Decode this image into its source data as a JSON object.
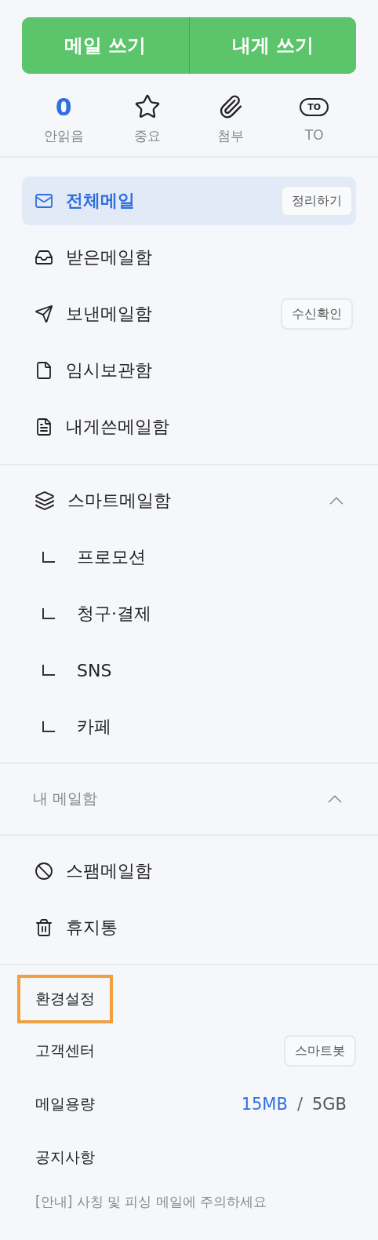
{
  "compose_buttons": [
    {
      "label": "메일 쓰기"
    },
    {
      "label": "내게 쓰기"
    }
  ],
  "quick_filters": [
    {
      "kind": "count",
      "value": "0",
      "label": "안읽음"
    },
    {
      "kind": "star",
      "label": "중요"
    },
    {
      "kind": "clip",
      "label": "첨부"
    },
    {
      "kind": "tag",
      "tag_text": "TO",
      "label": "TO"
    }
  ],
  "folders": [
    {
      "kind": "mail",
      "label": "전체메일",
      "selected": true,
      "action": "정리하기"
    },
    {
      "kind": "inbox",
      "label": "받은메일함",
      "selected": false
    },
    {
      "kind": "send",
      "label": "보낸메일함",
      "selected": false,
      "action": "수신확인"
    },
    {
      "kind": "draft",
      "label": "임시보관함",
      "selected": false
    },
    {
      "kind": "note",
      "label": "내게쓴메일함",
      "selected": false
    }
  ],
  "smart_folder": {
    "label": "스마트메일함",
    "expanded": true,
    "children": [
      {
        "label": "프로모션"
      },
      {
        "label": "청구·결제"
      },
      {
        "label": "SNS"
      },
      {
        "label": "카페"
      }
    ]
  },
  "my_mailbox": {
    "label": "내 메일함",
    "expanded": true
  },
  "system_folders": [
    {
      "kind": "spam",
      "label": "스팸메일함"
    },
    {
      "kind": "trash",
      "label": "휴지통"
    }
  ],
  "footer": {
    "settings": {
      "label": "환경설정",
      "highlighted": true
    },
    "support": {
      "label": "고객센터",
      "action": "스마트봇"
    },
    "storage": {
      "label": "메일용량",
      "used": "15MB",
      "separator": "/",
      "total": "5GB"
    },
    "notices": {
      "label": "공지사항"
    },
    "notice_text": "[안내] 사칭 및 피싱 메일에 주의하세요"
  }
}
